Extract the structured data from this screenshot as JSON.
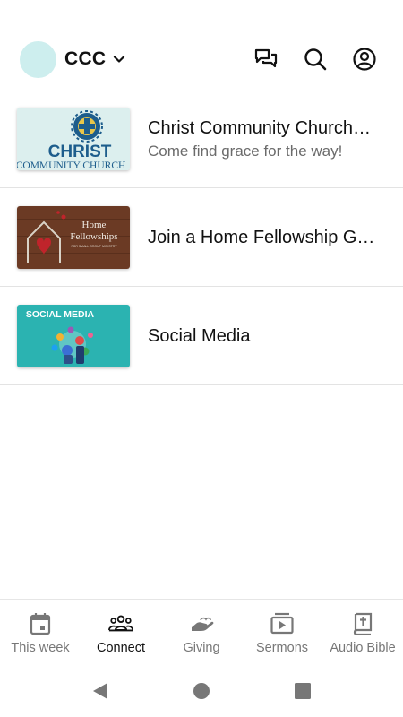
{
  "header": {
    "org_name": "CCC",
    "icons": [
      "chat-bubbles-icon",
      "search-icon",
      "account-icon"
    ]
  },
  "list": {
    "items": [
      {
        "title": "Christ Community Church…",
        "subtitle": "Come find grace for the way!",
        "thumb_lines": [
          "CHRIST",
          "COMMUNITY CHURCH"
        ]
      },
      {
        "title": "Join a Home Fellowship G…",
        "thumb_lines": [
          "Home",
          "Fellowships",
          "FOR SMALL GROUP MINISTRY"
        ]
      },
      {
        "title": "Social Media",
        "thumb_lines": [
          "SOCIAL MEDIA"
        ]
      }
    ]
  },
  "tabs": [
    {
      "label": "This week",
      "icon": "calendar-icon",
      "active": false
    },
    {
      "label": "Connect",
      "icon": "people-icon",
      "active": true
    },
    {
      "label": "Giving",
      "icon": "giving-hand-icon",
      "active": false
    },
    {
      "label": "Sermons",
      "icon": "play-video-icon",
      "active": false
    },
    {
      "label": "Audio Bible",
      "icon": "bible-icon",
      "active": false
    }
  ],
  "colors": {
    "avatar": "#cdeeee",
    "active_tab": "#111111",
    "inactive_tab": "#777777",
    "divider": "#e3e3e3"
  }
}
